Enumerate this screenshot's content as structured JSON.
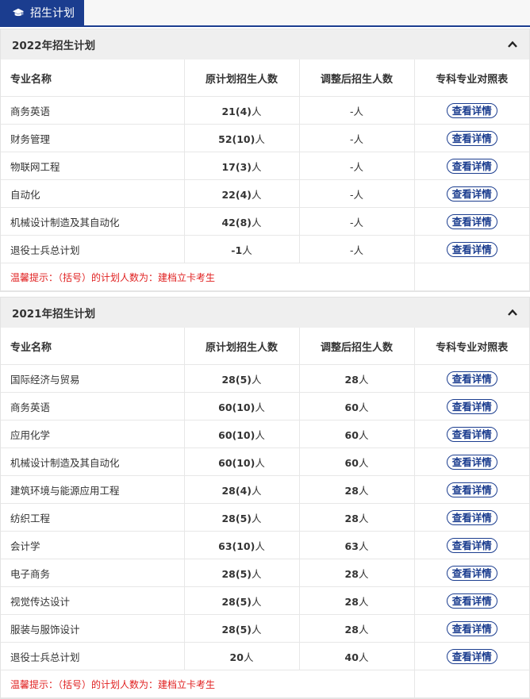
{
  "tab": {
    "label": "招生计划",
    "icon": "graduation-cap-icon"
  },
  "columns": [
    "专业名称",
    "原计划招生人数",
    "调整后招生人数",
    "专科专业对照表"
  ],
  "detail_label": "查看详情",
  "sections": [
    {
      "title": "2022年招生计划",
      "rows": [
        {
          "name": "商务英语",
          "planned": "21(4)",
          "adjusted": "-"
        },
        {
          "name": "财务管理",
          "planned": "52(10)",
          "adjusted": "-"
        },
        {
          "name": "物联网工程",
          "planned": "17(3)",
          "adjusted": "-"
        },
        {
          "name": "自动化",
          "planned": "22(4)",
          "adjusted": "-"
        },
        {
          "name": "机械设计制造及其自动化",
          "planned": "42(8)",
          "adjusted": "-"
        },
        {
          "name": "退役士兵总计划",
          "planned": "-1",
          "adjusted": "-"
        }
      ],
      "note": "温馨提示：（括号）的计划人数为：建档立卡考生"
    },
    {
      "title": "2021年招生计划",
      "rows": [
        {
          "name": "国际经济与贸易",
          "planned": "28(5)",
          "adjusted": "28"
        },
        {
          "name": "商务英语",
          "planned": "60(10)",
          "adjusted": "60"
        },
        {
          "name": "应用化学",
          "planned": "60(10)",
          "adjusted": "60"
        },
        {
          "name": "机械设计制造及其自动化",
          "planned": "60(10)",
          "adjusted": "60"
        },
        {
          "name": "建筑环境与能源应用工程",
          "planned": "28(4)",
          "adjusted": "28"
        },
        {
          "name": "纺织工程",
          "planned": "28(5)",
          "adjusted": "28"
        },
        {
          "name": "会计学",
          "planned": "63(10)",
          "adjusted": "63"
        },
        {
          "name": "电子商务",
          "planned": "28(5)",
          "adjusted": "28"
        },
        {
          "name": "视觉传达设计",
          "planned": "28(5)",
          "adjusted": "28"
        },
        {
          "name": "服装与服饰设计",
          "planned": "28(5)",
          "adjusted": "28"
        },
        {
          "name": "退役士兵总计划",
          "planned": "20",
          "adjusted": "40"
        }
      ],
      "note": "温馨提示：（括号）的计划人数为：建档立卡考生"
    }
  ],
  "unit": "人",
  "colors": {
    "primary": "#1b3d8f",
    "note": "#e02020"
  }
}
